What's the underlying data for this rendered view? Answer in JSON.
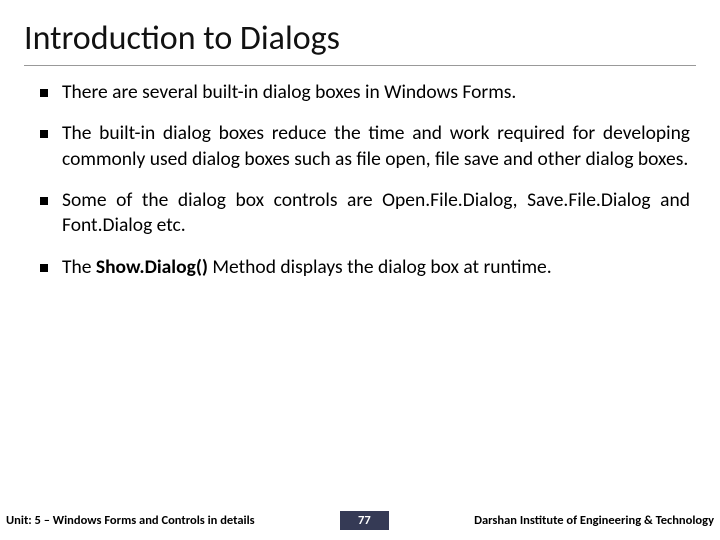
{
  "title": "Introduction to Dialogs",
  "bullets": {
    "b1": "There are several built-in dialog boxes in Windows Forms.",
    "b2": "The built-in dialog boxes reduce the time and work required for developing commonly used dialog boxes such as file open, file save and other dialog boxes.",
    "b3a": "Some of the dialog box controls are Open.File.Dialog, Save.File.Dialog and Font.Dialog etc.",
    "b4a": "The ",
    "b4b": "Show.Dialog()",
    "b4c": " Method displays the dialog box at runtime."
  },
  "footer": {
    "unit": "Unit: 5 – Windows Forms and Controls in details",
    "page": "77",
    "org": "Darshan Institute of Engineering & Technology"
  }
}
